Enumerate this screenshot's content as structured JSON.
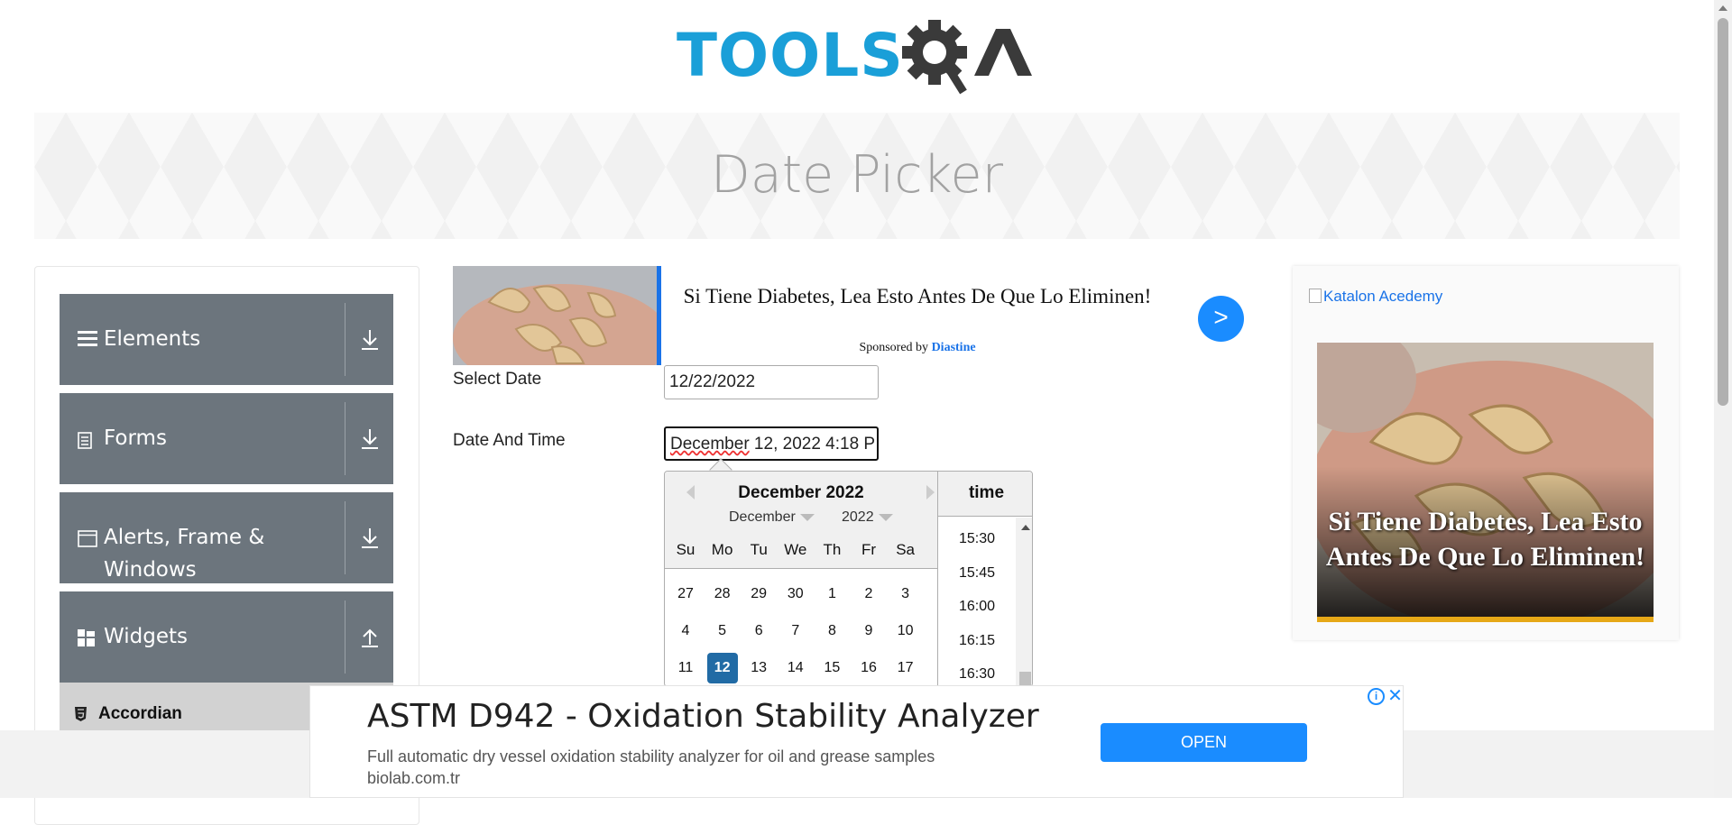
{
  "header": {
    "logo_text": "TOOLSQA",
    "page_title": "Date Picker"
  },
  "sidebar": {
    "groups": [
      {
        "label": "Elements",
        "icon": "hamburger-icon",
        "expanded": false
      },
      {
        "label": "Forms",
        "icon": "document-icon",
        "expanded": false
      },
      {
        "label": "Alerts, Frame &",
        "label2": "Windows",
        "icon": "window-icon",
        "expanded": false
      },
      {
        "label": "Widgets",
        "icon": "grid-icon",
        "expanded": true
      }
    ],
    "sub_items": [
      {
        "label": "Accordian",
        "icon": "html5-icon"
      }
    ]
  },
  "top_ad": {
    "headline": "Si Tiene Diabetes, Lea Esto Antes De Que Lo Eliminen!",
    "sponsored_prefix": "Sponsored by",
    "sponsor": "Diastine",
    "go_label": ">"
  },
  "form": {
    "select_date_label": "Select Date",
    "select_date_value": "12/22/2022",
    "date_time_label": "Date And Time",
    "date_time_value_word": "December",
    "date_time_value_rest": " 12, 2022 4:18 P"
  },
  "datepicker": {
    "month_title": "December 2022",
    "month_select": "December",
    "year_select": "2022",
    "weekdays": [
      "Su",
      "Mo",
      "Tu",
      "We",
      "Th",
      "Fr",
      "Sa"
    ],
    "weeks": [
      [
        "27",
        "28",
        "29",
        "30",
        "1",
        "2",
        "3"
      ],
      [
        "4",
        "5",
        "6",
        "7",
        "8",
        "9",
        "10"
      ],
      [
        "11",
        "12",
        "13",
        "14",
        "15",
        "16",
        "17"
      ]
    ],
    "selected_day": "12",
    "time_header": "time",
    "time_slots": [
      "15:30",
      "15:45",
      "16:00",
      "16:15",
      "16:30"
    ]
  },
  "right_ad": {
    "link_text": "Katalon Acedemy",
    "overlay_text": "Si Tiene Diabetes, Lea Esto Antes De Que Lo Eliminen!"
  },
  "footer_ad": {
    "title": "ASTM D942 - Oxidation Stability Analyzer",
    "description": "Full automatic dry vessel oxidation stability analyzer for oil and grease samples",
    "domain": "biolab.com.tr",
    "open_label": "OPEN",
    "info_label": "i",
    "close_label": "✕"
  },
  "colors": {
    "brand_blue": "#1a9fd8",
    "sidebar_group": "#6c757d",
    "selected_day": "#216ba5",
    "ad_button": "#1a8cff"
  }
}
